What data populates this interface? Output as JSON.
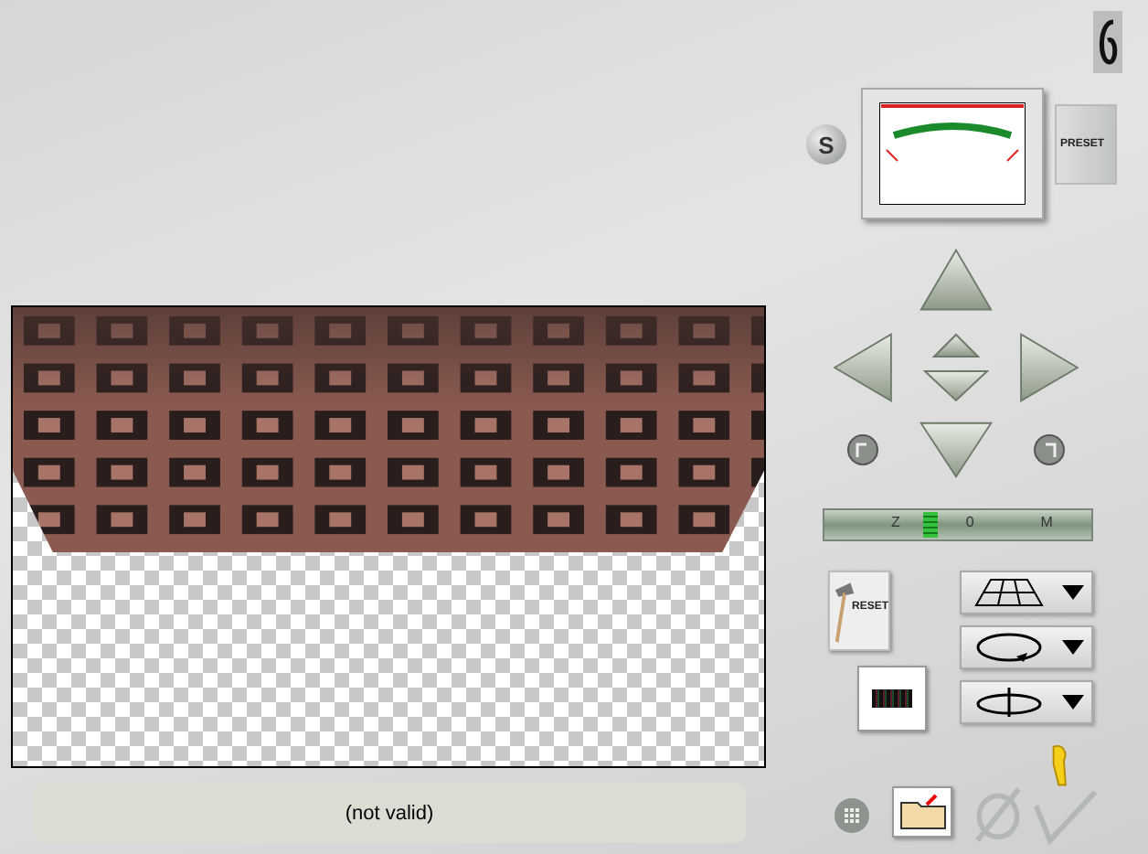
{
  "header": {
    "style_button": "S",
    "presets_button": "PRESET"
  },
  "zoom_slider": {
    "ticks": [
      "Z",
      "0",
      "M"
    ],
    "level": 0.4
  },
  "reset_button": {
    "label": "RESET"
  },
  "dropdowns": [
    {
      "kind": "grid"
    },
    {
      "kind": "rotate"
    },
    {
      "kind": "flip"
    }
  ],
  "status_bar": {
    "text": "(not valid)"
  }
}
